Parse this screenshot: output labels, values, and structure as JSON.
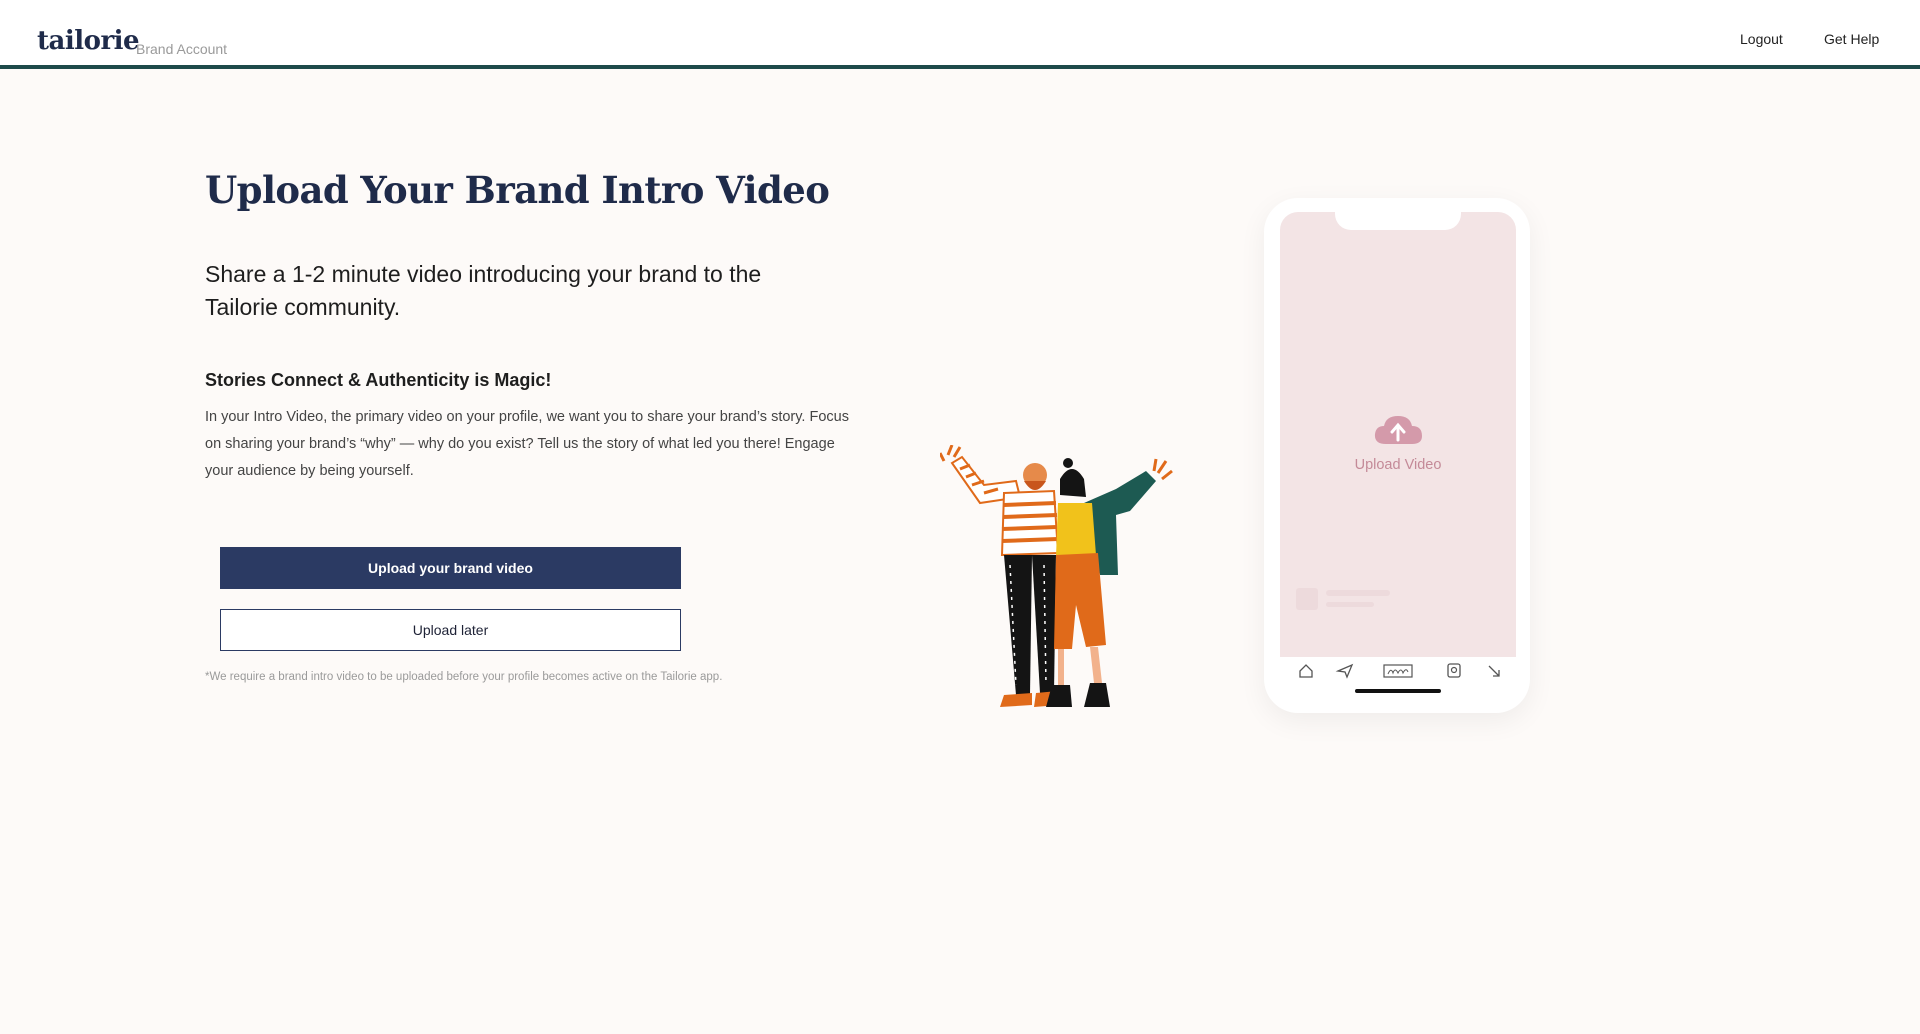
{
  "header": {
    "logo": "tailorie",
    "logo_subtitle": "Brand Account",
    "nav": {
      "logout": "Logout",
      "help": "Get Help"
    }
  },
  "main": {
    "title": "Upload Your Brand Intro Video",
    "subtitle": "Share a 1-2 minute video introducing your brand to the Tailorie community.",
    "section_heading": "Stories Connect & Authenticity is Magic!",
    "body": "In your Intro Video, the primary video on your profile, we want you to share your brand’s story. Focus on sharing your brand’s “why” — why do you exist? Tell us the story of what led you there! Engage your audience by being yourself.",
    "primary_button": "Upload your brand video",
    "secondary_button": "Upload later",
    "footnote": "*We require a brand intro video to be uploaded before your profile becomes active on the Tailorie app."
  },
  "phone": {
    "upload_label": "Upload Video",
    "nav_icons": [
      "home-icon",
      "send-icon",
      "signature-icon",
      "search-icon",
      "arrow-icon"
    ]
  },
  "colors": {
    "brand_navy": "#2b3a63",
    "header_rule": "#1d4a4a",
    "phone_screen": "#f3e4e5",
    "upload_accent": "#c48a98"
  }
}
